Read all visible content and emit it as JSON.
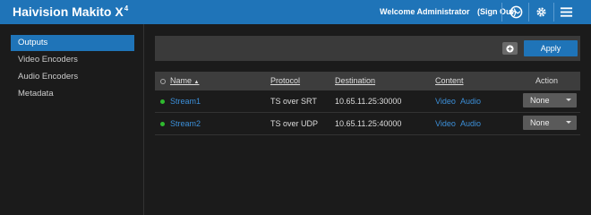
{
  "header": {
    "brand": "Haivision Makito X",
    "brand_superscript": "4",
    "welcome": "Welcome Administrator",
    "sign_out": "(Sign Out)",
    "icons": [
      "status-icon",
      "gear-icon",
      "menu-icon"
    ]
  },
  "sidebar": {
    "items": [
      {
        "label": "Outputs",
        "active": true
      },
      {
        "label": "Video Encoders",
        "active": false
      },
      {
        "label": "Audio Encoders",
        "active": false
      },
      {
        "label": "Metadata",
        "active": false
      }
    ]
  },
  "toolbar": {
    "add_icon": "plus-icon",
    "apply_label": "Apply"
  },
  "table": {
    "headers": {
      "name": "Name",
      "protocol": "Protocol",
      "destination": "Destination",
      "content": "Content",
      "action": "Action"
    },
    "sort_indicator": "▲",
    "rows": [
      {
        "name": "Stream1",
        "protocol": "TS over SRT",
        "destination": "10.65.11.25:30000",
        "content_video": "Video",
        "content_audio": "Audio",
        "action": "None",
        "status_color": "#2fba2f"
      },
      {
        "name": "Stream2",
        "protocol": "TS over UDP",
        "destination": "10.65.11.25:40000",
        "content_video": "Video",
        "content_audio": "Audio",
        "action": "None",
        "status_color": "#2fba2f"
      }
    ]
  },
  "colors": {
    "accent": "#1f74b8",
    "background": "#1b1b1b",
    "link": "#3c8fd8",
    "status_ok": "#2fba2f"
  }
}
